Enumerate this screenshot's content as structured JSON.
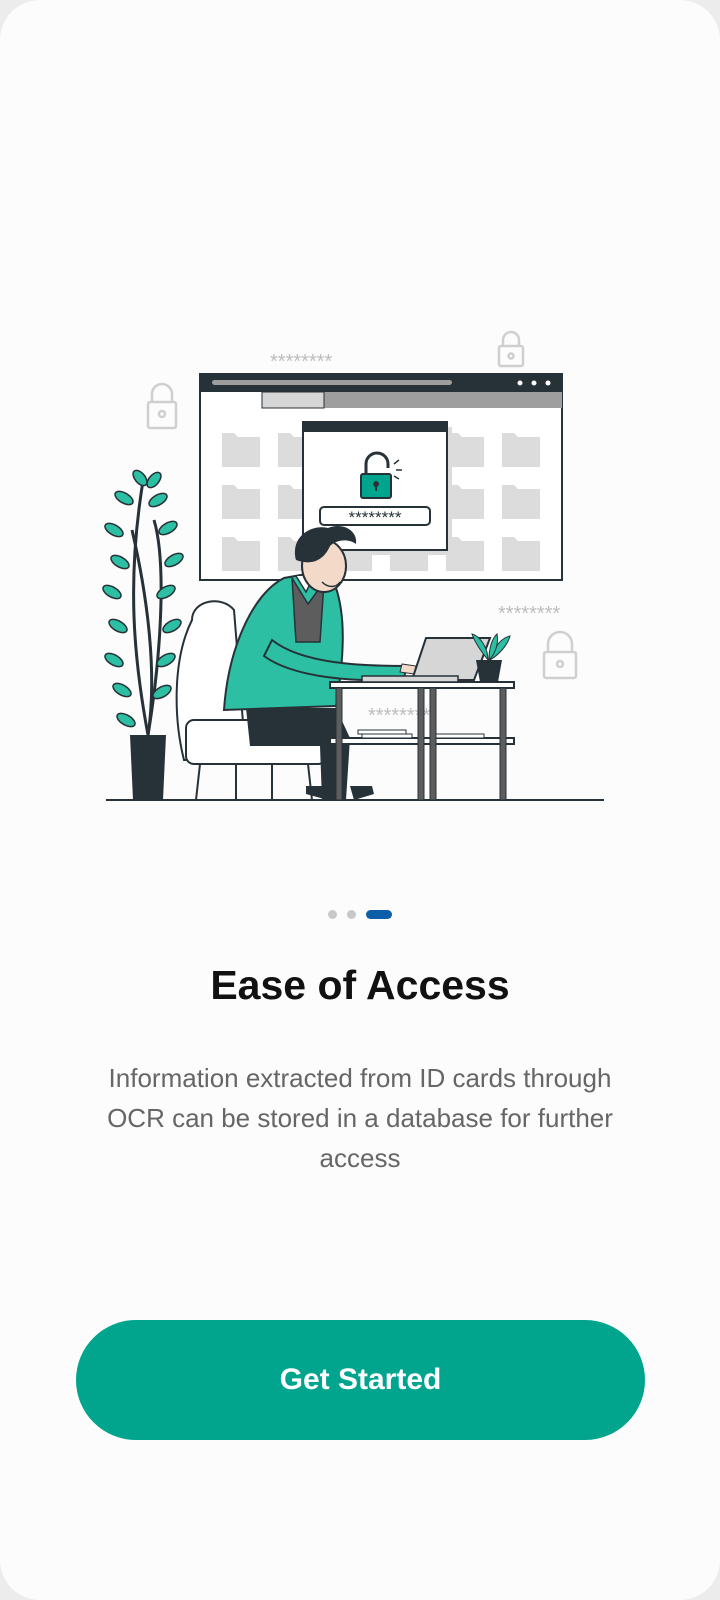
{
  "onboarding": {
    "title": "Ease of Access",
    "description": "Information extracted from ID cards through OCR can be stored in a database for further access",
    "page_index": 3,
    "page_count": 3,
    "cta_label": "Get Started",
    "password_mask": "********"
  },
  "colors": {
    "accent_teal": "#01a58e",
    "active_dot": "#0d5ea8",
    "inactive_dot": "#c8c8c8",
    "dark": "#263238"
  },
  "icons": [
    "lock-icon",
    "unlock-icon"
  ]
}
